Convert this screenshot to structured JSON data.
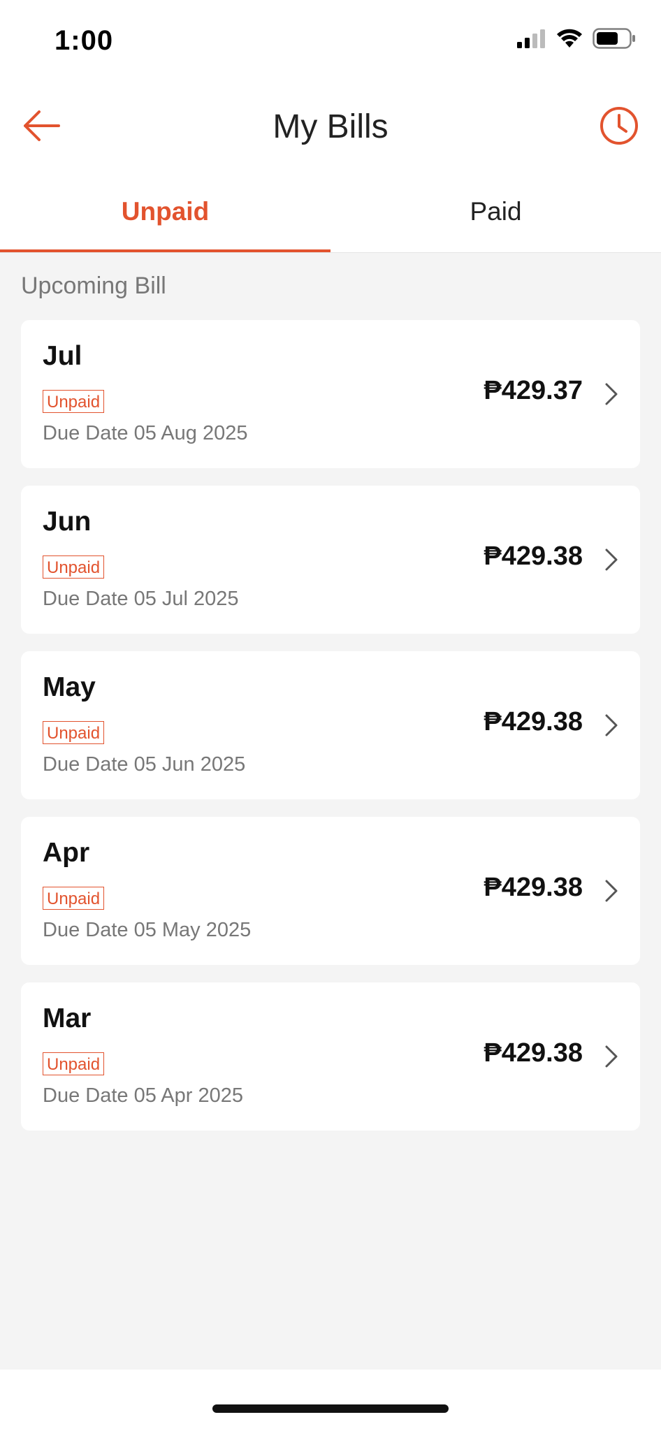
{
  "status_bar": {
    "time": "1:00",
    "icons": [
      "cellular-signal-icon",
      "wifi-icon",
      "battery-icon"
    ]
  },
  "header": {
    "title": "My Bills",
    "back_icon": "arrow-left-icon",
    "history_icon": "clock-icon"
  },
  "tabs": [
    {
      "label": "Unpaid",
      "active": true
    },
    {
      "label": "Paid",
      "active": false
    }
  ],
  "section": {
    "label": "Upcoming Bill"
  },
  "bills": [
    {
      "month": "Jul",
      "status": "Unpaid",
      "due": "Due Date 05 Aug 2025",
      "amount": "₱429.37"
    },
    {
      "month": "Jun",
      "status": "Unpaid",
      "due": "Due Date 05 Jul 2025",
      "amount": "₱429.38"
    },
    {
      "month": "May",
      "status": "Unpaid",
      "due": "Due Date 05 Jun 2025",
      "amount": "₱429.38"
    },
    {
      "month": "Apr",
      "status": "Unpaid",
      "due": "Due Date 05 May 2025",
      "amount": "₱429.38"
    },
    {
      "month": "Mar",
      "status": "Unpaid",
      "due": "Due Date 05 Apr 2025",
      "amount": "₱429.38"
    }
  ],
  "colors": {
    "accent": "#e2532e",
    "background": "#f4f4f4",
    "card": "#ffffff",
    "text_primary": "#111111",
    "text_secondary": "#777777"
  }
}
